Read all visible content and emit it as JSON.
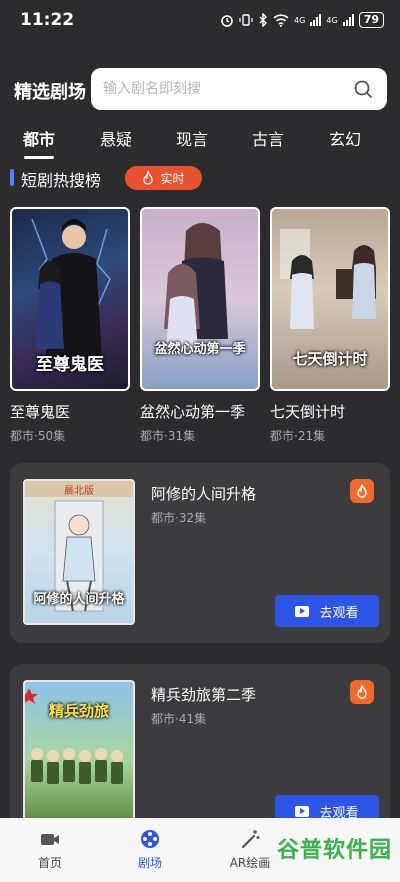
{
  "status_bar": {
    "time": "11:22",
    "signal_a": "4G",
    "signal_b": "4G",
    "battery": "79"
  },
  "header": {
    "title": "精选剧场"
  },
  "search": {
    "placeholder": "输入剧名即刻搜"
  },
  "tabs": [
    {
      "label": "都市"
    },
    {
      "label": "悬疑"
    },
    {
      "label": "现言"
    },
    {
      "label": "古言"
    },
    {
      "label": "玄幻"
    }
  ],
  "section": {
    "title": "短剧热搜榜",
    "badge": "实时"
  },
  "hot_dramas": [
    {
      "title": "至尊鬼医",
      "meta": "都市·50集",
      "cover_text": "至尊鬼医"
    },
    {
      "title": "盆然心动第一季",
      "meta": "都市·31集",
      "cover_text": "盆然心动第一季"
    },
    {
      "title": "七天倒计时",
      "meta": "都市·21集",
      "cover_text": "七天倒计时"
    }
  ],
  "featured_dramas": [
    {
      "title": "阿修的人间升格",
      "meta": "都市·32集",
      "cover_text": "阿修的人间升格",
      "cover_top": "晨北版",
      "button": "去观看"
    },
    {
      "title": "精兵劲旅第二季",
      "meta": "都市·41集",
      "cover_text": "精兵劲旅",
      "button": "去观看"
    }
  ],
  "bottom_nav": [
    {
      "label": "首页",
      "icon": "video-camera-icon"
    },
    {
      "label": "剧场",
      "icon": "film-reel-icon"
    },
    {
      "label": "AR绘画",
      "icon": "magic-wand-icon"
    }
  ],
  "watermark": "谷普软件园",
  "colors": {
    "background": "#2c2c2e",
    "accent": "#2c55e8",
    "badge": "#e8522f",
    "fire": "#f06a2a",
    "section_bar": "#5b7cff"
  }
}
